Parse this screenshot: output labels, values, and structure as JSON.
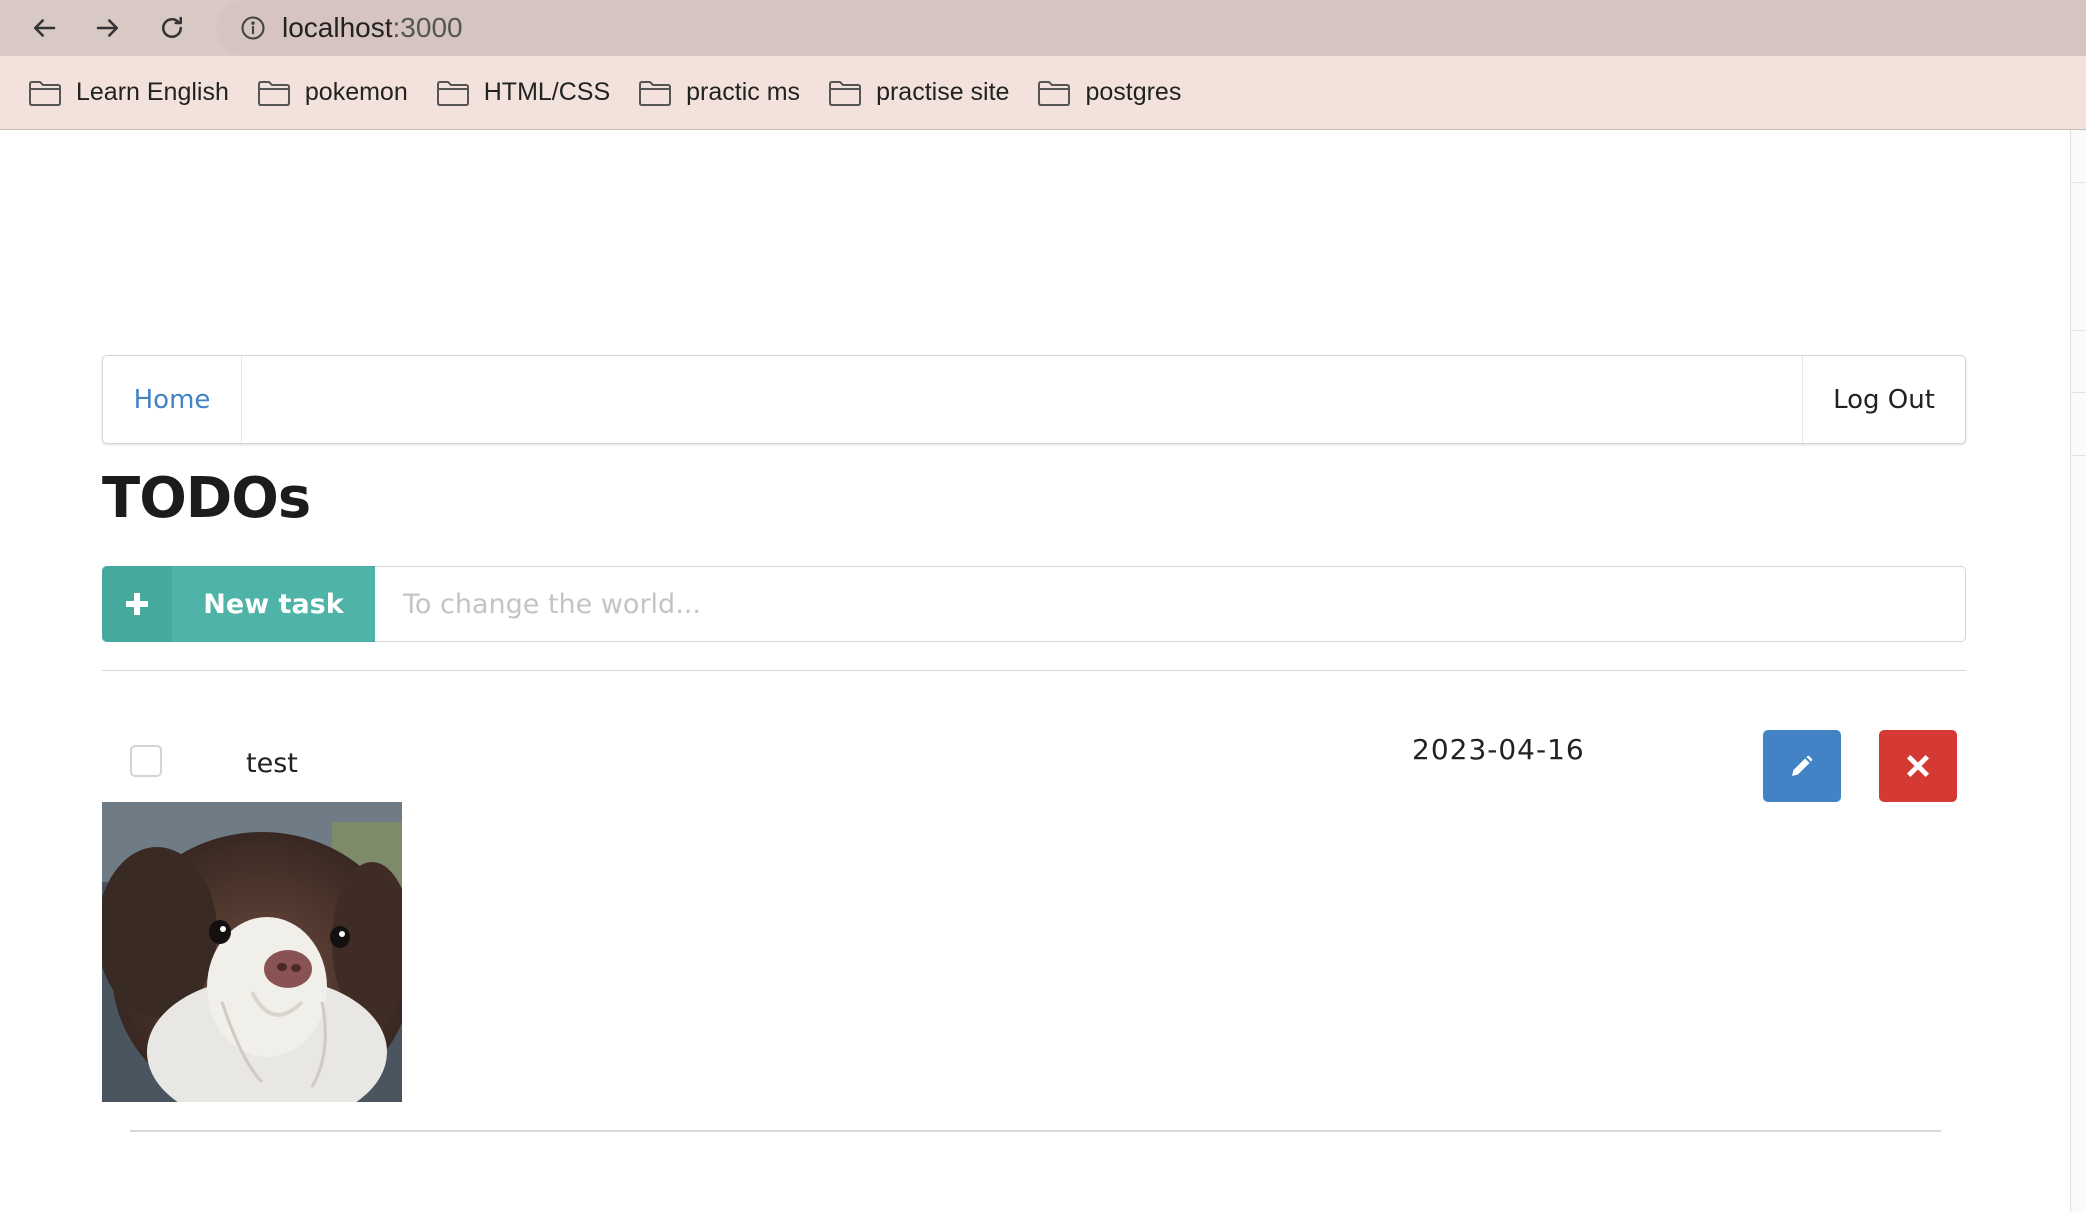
{
  "browser": {
    "url_host": "localhost",
    "url_port": ":3000",
    "bookmarks": [
      {
        "label": "Learn English"
      },
      {
        "label": "pokemon"
      },
      {
        "label": "HTML/CSS"
      },
      {
        "label": "practic ms"
      },
      {
        "label": "practise site"
      },
      {
        "label": "postgres"
      }
    ]
  },
  "menu": {
    "home_label": "Home",
    "logout_label": "Log Out"
  },
  "page": {
    "title": "TODOs"
  },
  "new_task": {
    "button_label": "New task",
    "input_placeholder": "To change the world...",
    "input_value": ""
  },
  "todos": [
    {
      "text": "test",
      "date": "2023-04-16",
      "completed": false,
      "image_subject": "dog-photo"
    }
  ],
  "colors": {
    "accent_teal": "#4fb3a8",
    "edit_blue": "#4183c4",
    "delete_red": "#d43a33",
    "link_blue": "#4183c4"
  }
}
